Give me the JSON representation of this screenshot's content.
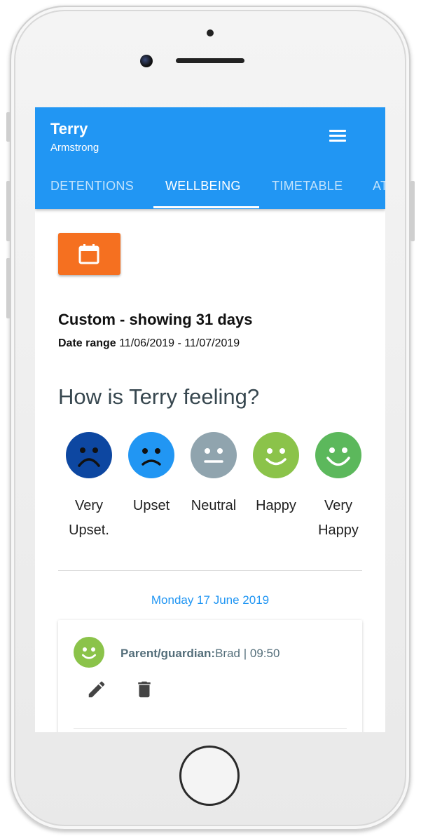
{
  "student": {
    "first_name": "Terry",
    "last_name": "Armstrong"
  },
  "tabs": [
    {
      "label": "DETENTIONS",
      "active": false
    },
    {
      "label": "WELLBEING",
      "active": true
    },
    {
      "label": "TIMETABLE",
      "active": false
    },
    {
      "label": "AT",
      "active": false
    }
  ],
  "date_range": {
    "title": "Custom - showing 31 days",
    "label": "Date range",
    "value": "11/06/2019 - 11/07/2019"
  },
  "feeling": {
    "heading": "How is Terry feeling?",
    "options": [
      {
        "label_line1": "Very",
        "label_line2": "Upset.",
        "color": "#0d47a1",
        "icon": "very-upset-face-icon"
      },
      {
        "label_line1": "Upset",
        "label_line2": "",
        "color": "#2196f3",
        "icon": "upset-face-icon"
      },
      {
        "label_line1": "Neutral",
        "label_line2": "",
        "color": "#90a4ae",
        "icon": "neutral-face-icon"
      },
      {
        "label_line1": "Happy",
        "label_line2": "",
        "color": "#8bc34a",
        "icon": "happy-face-icon"
      },
      {
        "label_line1": "Very",
        "label_line2": "Happy",
        "color": "#5cb85c",
        "icon": "very-happy-face-icon"
      }
    ]
  },
  "entries": {
    "day_heading": "Monday 17 June 2019",
    "items": [
      {
        "author_role": "Parent/guardian:",
        "author_name": "Brad",
        "separator": " | ",
        "time": "09:50",
        "mood_icon": "happy-face-icon"
      }
    ]
  },
  "colors": {
    "primary": "#2196f3",
    "accent_orange": "#f57020"
  }
}
